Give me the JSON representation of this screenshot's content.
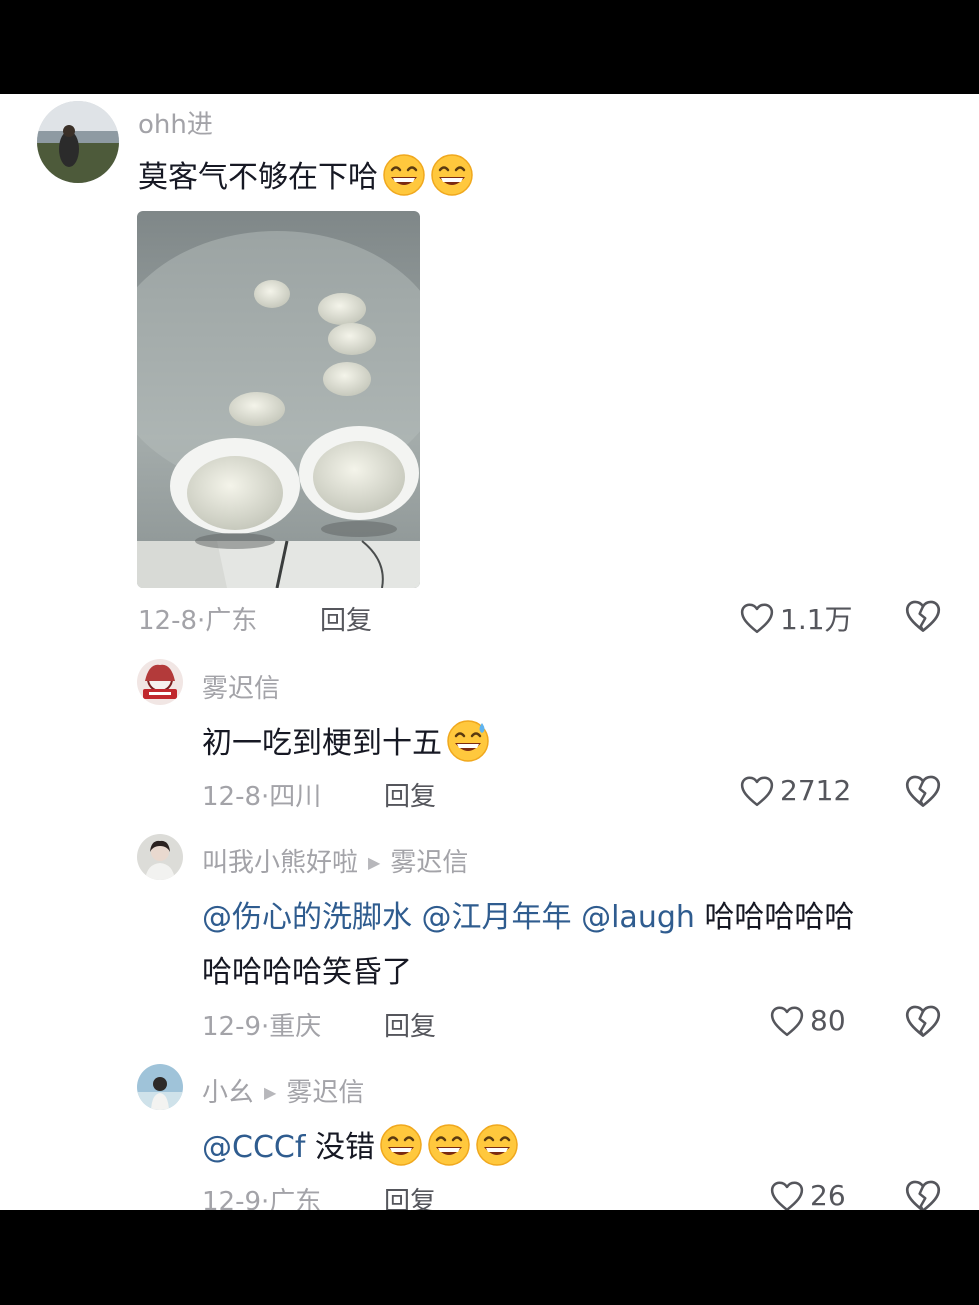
{
  "comments": [
    {
      "user": "ohh进",
      "text": "莫客气不够在下哈",
      "date": "12-8",
      "location": "广东",
      "reply_label": "回复",
      "likes": "1.1万"
    },
    {
      "user": "雾迟信",
      "text": "初一吃到梗到十五",
      "date": "12-8",
      "location": "四川",
      "reply_label": "回复",
      "likes": "2712"
    },
    {
      "user": "叫我小熊好啦",
      "reply_to": "雾迟信",
      "mentions": [
        "@伤心的洗脚水",
        "@江月年年",
        "@laugh"
      ],
      "text_line1": "哈哈哈哈哈",
      "text_line2": "哈哈哈哈笑昏了",
      "date": "12-9",
      "location": "重庆",
      "reply_label": "回复",
      "likes": "80"
    },
    {
      "user": "小幺",
      "reply_to": "雾迟信",
      "mention": "@CCCf",
      "text": "没错",
      "date": "12-9",
      "location": "广东",
      "reply_label": "回复",
      "likes": "26"
    }
  ],
  "separator": "·",
  "colors": {
    "mention": "#2f5c8f",
    "meta": "#a3a3a8",
    "text": "#161823"
  }
}
